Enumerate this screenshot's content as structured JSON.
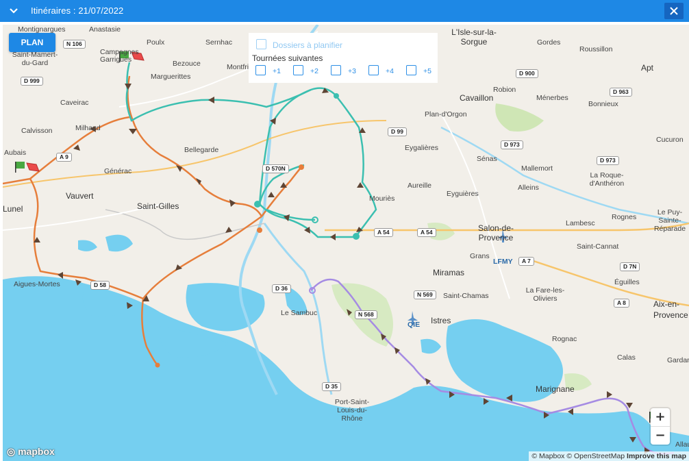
{
  "header": {
    "title": "Itinéraires : 21/07/2022",
    "color": "#1e88e5"
  },
  "controls": {
    "plan_label": "PLAN",
    "dossiers_label": "Dossiers à planifier",
    "tournees_label": "Tournées suivantes",
    "next_options": [
      "+1",
      "+2",
      "+3",
      "+4",
      "+5"
    ],
    "zoom_in": "+",
    "zoom_out": "−"
  },
  "map": {
    "logo": "mapbox",
    "attribution": [
      "© Mapbox",
      "© OpenStreetMap",
      "Improve this map"
    ],
    "route_colors": {
      "orange": "#e67e3b",
      "teal": "#3bbfb0",
      "purple": "#a58be3"
    },
    "places": [
      "Montignargues",
      "Anastasie",
      "Sernhac",
      "Poulx",
      "Campagnes Garrigues",
      "Saint-Mamert-du-Gard",
      "Marguerittes",
      "Bezouce",
      "Montfrin",
      "L'Isle-sur-la-Sorgue",
      "Gordes",
      "Roussillon",
      "Apt",
      "Caveirac",
      "Cavaillon",
      "Robion",
      "Ménerbes",
      "Bonnieux",
      "Milhaud",
      "Calvisson",
      "Plan-d'Orgon",
      "Eygalières",
      "Cucuron",
      "Aubais",
      "Bellegarde",
      "Générac",
      "Sénas",
      "Mallemort",
      "Alleins",
      "La Roque-d'Anthéron",
      "Vauvert",
      "Saint-Gilles",
      "Aureille",
      "Eyguières",
      "Mouriès",
      "Lunel",
      "Salon-de-Provence",
      "Lambesc",
      "Rognes",
      "Le Puy-Sainte-Réparade",
      "Grans",
      "Saint-Cannat",
      "Aigues-Mortes",
      "Miramas",
      "Éguilles",
      "Saint-Chamas",
      "La Fare-les-Oliviers",
      "Aix-en-Provence",
      "Le Sambuc",
      "Istres",
      "Rognac",
      "Calas",
      "Gardanne",
      "Marignane",
      "Port-Saint-Louis-du-Rhône",
      "Allauch"
    ],
    "roads": [
      "N 106",
      "D 999",
      "A 9",
      "D 570N",
      "D 99",
      "D 900",
      "D 963",
      "D 973",
      "D 973",
      "A 54",
      "A 54",
      "A 7",
      "D 7N",
      "A 8",
      "D 58",
      "D 36",
      "N 568",
      "N 569",
      "D 35"
    ],
    "airports": [
      "LFMY",
      "QIE"
    ]
  }
}
